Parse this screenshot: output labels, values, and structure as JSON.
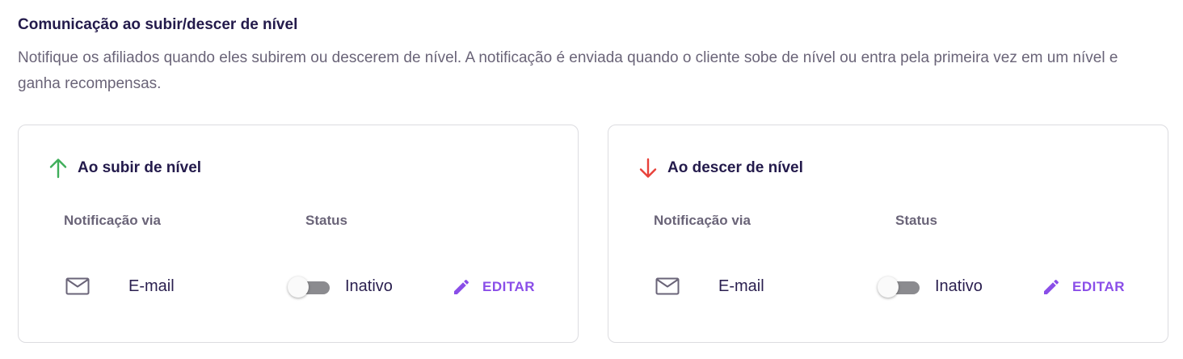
{
  "section": {
    "title": "Comunicação ao subir/descer de nível",
    "description": "Notifique os afiliados quando eles subirem ou descerem de nível. A notificação é enviada quando o cliente sobe de nível ou entra pela primeira vez em um nível e ganha recompensas."
  },
  "cards": [
    {
      "title": "Ao subir de nível",
      "icon": "arrow-up-icon",
      "icon_color": "#3fae5a",
      "columns": {
        "via": "Notificação via",
        "status": "Status"
      },
      "row": {
        "channel_icon": "mail-icon",
        "channel": "E-mail",
        "toggle_on": false,
        "status": "Inativo",
        "edit_label": "EDITAR",
        "edit_icon": "pencil-icon"
      }
    },
    {
      "title": "Ao descer de nível",
      "icon": "arrow-down-icon",
      "icon_color": "#e8413a",
      "columns": {
        "via": "Notificação via",
        "status": "Status"
      },
      "row": {
        "channel_icon": "mail-icon",
        "channel": "E-mail",
        "toggle_on": false,
        "status": "Inativo",
        "edit_label": "EDITAR",
        "edit_icon": "pencil-icon"
      }
    }
  ],
  "colors": {
    "accent": "#8a4ee8",
    "title": "#231a4b",
    "muted": "#6a6478",
    "toggle_track_off": "#8b8b8f"
  }
}
